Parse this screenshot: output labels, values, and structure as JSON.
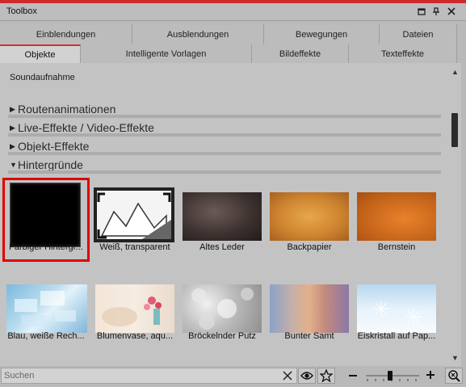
{
  "window": {
    "title": "Toolbox",
    "controls": [
      "restore-icon",
      "pin-icon",
      "close-icon"
    ]
  },
  "tabs_row1": [
    {
      "label": "Einblendungen"
    },
    {
      "label": "Ausblendungen"
    },
    {
      "label": "Bewegungen"
    },
    {
      "label": "Dateien"
    }
  ],
  "tabs_row2": [
    {
      "label": "Objekte",
      "active": true
    },
    {
      "label": "Intelligente Vorlagen"
    },
    {
      "label": "Bildeffekte"
    },
    {
      "label": "Texteffekte"
    }
  ],
  "subtitle": "Soundaufnahme",
  "sections": [
    {
      "label": "Routenanimationen",
      "expanded": false
    },
    {
      "label": "Live-Effekte / Video-Effekte",
      "expanded": false
    },
    {
      "label": "Objekt-Effekte",
      "expanded": false
    },
    {
      "label": "Hintergründe",
      "expanded": true
    }
  ],
  "items": [
    {
      "label": "Farbiger Hintergr...",
      "selected": true
    },
    {
      "label": "Weiß, transparent"
    },
    {
      "label": "Altes Leder"
    },
    {
      "label": "Backpapier"
    },
    {
      "label": "Bernstein"
    },
    {
      "label": "Blau, weiße Rech..."
    },
    {
      "label": "Blumenvase, aqu..."
    },
    {
      "label": "Bröckelnder Putz"
    },
    {
      "label": "Bunter Samt"
    },
    {
      "label": "Eiskristall auf Pap..."
    }
  ],
  "search": {
    "placeholder": "Suchen",
    "value": ""
  },
  "bottom_icons": [
    "clear-icon",
    "eye-icon",
    "star-icon",
    "zoom-out-icon",
    "zoom-in-icon",
    "fit-zoom-icon"
  ],
  "zoom": {
    "level": 0.45
  },
  "colors": {
    "accent": "#d23232",
    "selection": "#e00000"
  }
}
